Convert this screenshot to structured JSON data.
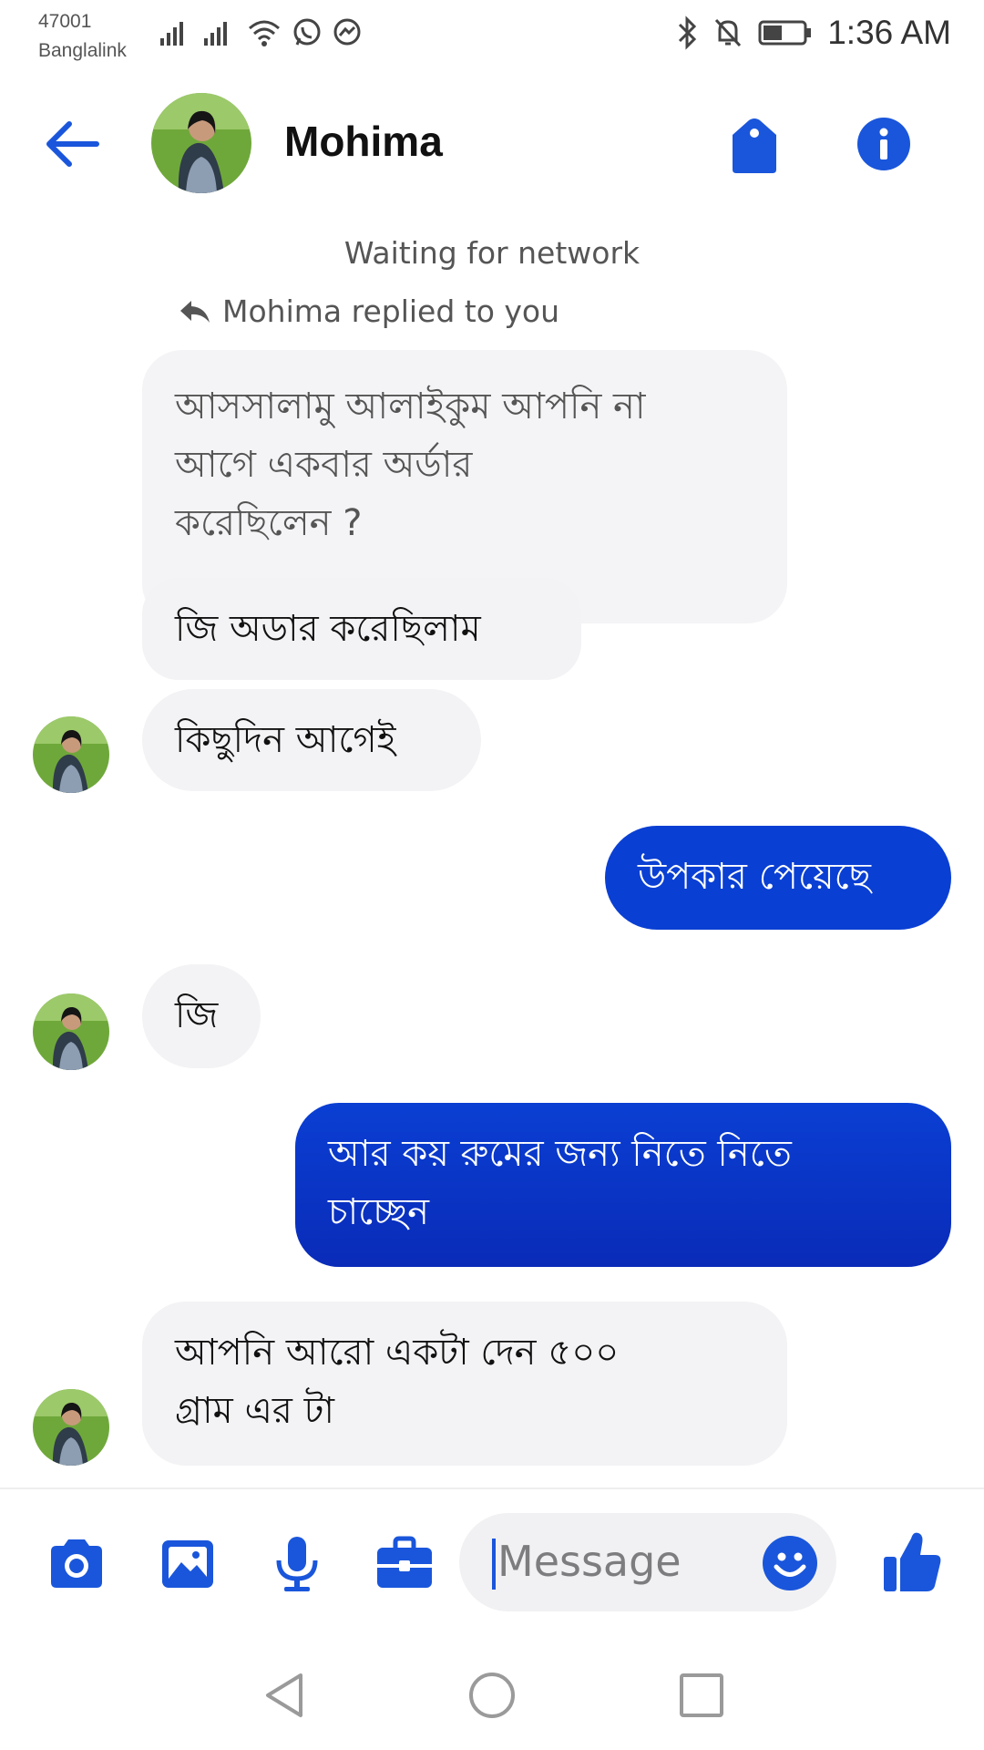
{
  "status_bar": {
    "carrier_code": "47001",
    "carrier_name": "Banglalink",
    "time": "1:36 AM"
  },
  "header": {
    "contact_name": "Mohima"
  },
  "conversation": {
    "network_status": "Waiting for network",
    "reply_notice": "Mohima replied to you",
    "quoted_message": {
      "lines": [
        "আসসালামু আলাইকুম আপনি না",
        "আগে একবার অর্ডার",
        "করেছিলেন ?"
      ]
    },
    "messages": [
      {
        "sender": "contact",
        "lines": [
          "জি অডার করেছিলাম"
        ]
      },
      {
        "sender": "contact",
        "lines": [
          "কিছুদিন আগেই"
        ]
      },
      {
        "sender": "me",
        "lines": [
          "উপকার পেয়েছে"
        ]
      },
      {
        "sender": "contact",
        "lines": [
          "জি"
        ]
      },
      {
        "sender": "me",
        "lines": [
          "আর কয় রুমের জন্য নিতে নিতে",
          "চাচ্ছেন"
        ]
      },
      {
        "sender": "contact",
        "lines": [
          "আপনি আরো একটা  দেন ৫০০",
          "গ্রাম এর টা"
        ]
      }
    ]
  },
  "composer": {
    "placeholder": "Message"
  },
  "colors": {
    "accent": "#1a56db",
    "outgoing_bubble_top": "#0a3fd3",
    "outgoing_bubble_bottom": "#0a2bb8",
    "incoming_bubble": "#f3f3f5"
  },
  "icons": {
    "header": [
      "back-arrow-icon",
      "tag-icon",
      "info-icon"
    ],
    "composer": [
      "camera-icon",
      "gallery-icon",
      "microphone-icon",
      "toolbox-icon",
      "emoji-icon",
      "thumbs-up-icon"
    ],
    "nav": [
      "nav-back-icon",
      "nav-home-icon",
      "nav-recents-icon"
    ]
  }
}
